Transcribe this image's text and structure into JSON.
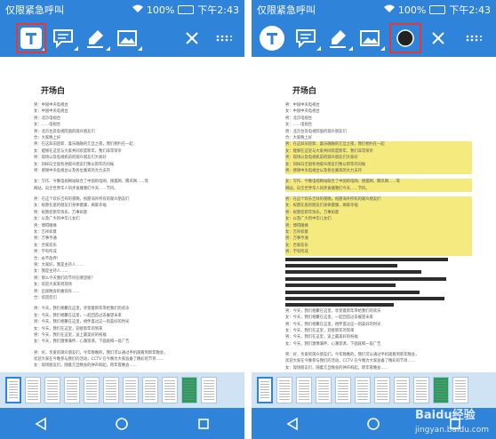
{
  "status_bar": {
    "carrier": "仅限紧急呼叫",
    "battery": "100%",
    "time": "下午2:43"
  },
  "toolbar": {
    "tools": [
      "text-tool",
      "comment-tool",
      "highlighter-tool",
      "image-tool",
      "close",
      "more"
    ],
    "left_selected": "text-tool",
    "right_selected": "color-swatch"
  },
  "document": {
    "title": "开场白",
    "left_lines": [
      "男：中国中央电视台",
      "女：中国中央电视台",
      "男：北京电视台",
      "女：……电视台",
      "男：北京台及电视院面的观众朋友们",
      "合：大家晚上好",
      "男：在这辞旧迎新、喜乐融融的元旦之夜，我们相约在一起",
      "女：能够在这里与大家共同欢度新年，我们非常荣幸",
      "男：现场以及电视机前的观众朋友们大家好",
      "女：同样向全国各地观众朋友们致以新年的问候",
      "男：感谢中央电视台以及各位嘉宾的大力支持",
      "",
      "女：写作、今晚电视网站联合了中国的电网、搜狐网、腾讯网……等",
      "网站，向全世界华人同步直播我们今天……节目。",
      "",
      "男：在这个欢乐吉祥的夜晚，祝愿海外所有的观众朋友们",
      "女：祝愿在座的朋友们身体健康，阖家幸福",
      "男：祝愿您新年快乐，万事如意",
      "女：以及广大的中华儿女们",
      "男：博得眼缘",
      "女：吉祥如意",
      "男：万事亨通",
      "女：合家欢乐",
      "男：学有所成",
      "合：永不放弃！",
      "男：大家好，我是主持人……",
      "女：我是主持人……",
      "男：那么今天我们的节目在哪里呢？",
      "女：欢迎大家来到现场",
      "男：出席晚会的嘉宾有……",
      "合：欢迎您们",
      "",
      "男：今天，我们相聚在这里，享受着新年带给我们的欢乐",
      "女：今天，我们相聚在这里，一起回首过去展望未来",
      "男：今天，我们相聚在这里，相伴度过这一刻美好的时光",
      "女：今天，我们在这里，迎接新年的到来",
      "男：今天，我们在这里，送上最美好的祝福",
      "女：今天，我们激情满怀、心潮澎湃，下面就揭一段广告",
      "",
      "男：好，亲爱的观众朋友们，今年晚晚的，我们可以通过手机观看到新年晚会，",
      "欢迎大家在今晚参与我们的活动，CCTV 在今晚为大家准备了精彩的节目……",
      "女：现场朋友们，随着元旦晚会的钟声响起，跨年夜晚会……"
    ],
    "right_lines": [
      "男：中国中央电视台",
      "女：中国中央电视台",
      "男：北京电视台",
      "女：……电视台",
      "男：北京台及电视院面的观众朋友们",
      "合：大家晚上好",
      "男：在这辞旧迎新、喜乐融融的元旦之夜，我们相约在一起",
      "女：能够在这里与大家共同欢度新年，我们非常荣幸",
      "男：现场以及电视机前的观众朋友们大家好",
      "女：同样向全国各地观众朋友们致以新年的问候",
      "男：感谢中央电视台以及各位嘉宾的大力支持",
      "",
      "女：写作、今晚电视网站联合了中国的电网、搜狐网、腾讯网……等",
      "网站，向全世界华人同步直播我们今天……节目。",
      "",
      "男：在这个欢乐吉祥的夜晚，祝愿海外所有的观众朋友们",
      "女：祝愿在座的朋友们身体健康，阖家幸福",
      "男：祝愿您新年快乐，万事如意",
      "女：以及广大的中华儿女们",
      "男：博得眼缘",
      "女：吉祥如意",
      "男：万事亨通",
      "女：合家欢乐",
      "男：学有所成",
      "",
      "",
      "",
      "",
      "",
      "",
      "",
      "",
      "男：今天，我们相聚在这里，享受着新年带给我们的欢乐",
      "女：今天，我们相聚在这里，一起回首过去展望未来",
      "男：今天，我们相聚在这里，相伴度过这一刻美好的时光",
      "女：今天，我们在这里，迎接新年的到来",
      "男：今天，我们在这里，送上最美好的祝福",
      "女：今天，我们激情满怀、心潮澎湃，下面就揭一段广告",
      "",
      "男：好，亲爱的观众朋友们，今年晚晚的，我们可以通过手机观看到新年晚会，",
      "欢迎大家在今晚参与我们的活动，CCTV 在今晚为大家准备了精彩的节目……",
      "女：现场朋友们，随着元旦晚会的钟声响起，跨年夜晚会……"
    ]
  },
  "thumbnails": {
    "count": 11,
    "active_index": 0,
    "green_index": 9
  },
  "navbar": [
    "back",
    "home",
    "recents"
  ],
  "watermark": {
    "brand": "Baidu经验",
    "url": "jingyan.baidu.com"
  },
  "colors": {
    "accent": "#2f83d8",
    "highlight": "#f4ea7d",
    "selection": "#e53935"
  }
}
